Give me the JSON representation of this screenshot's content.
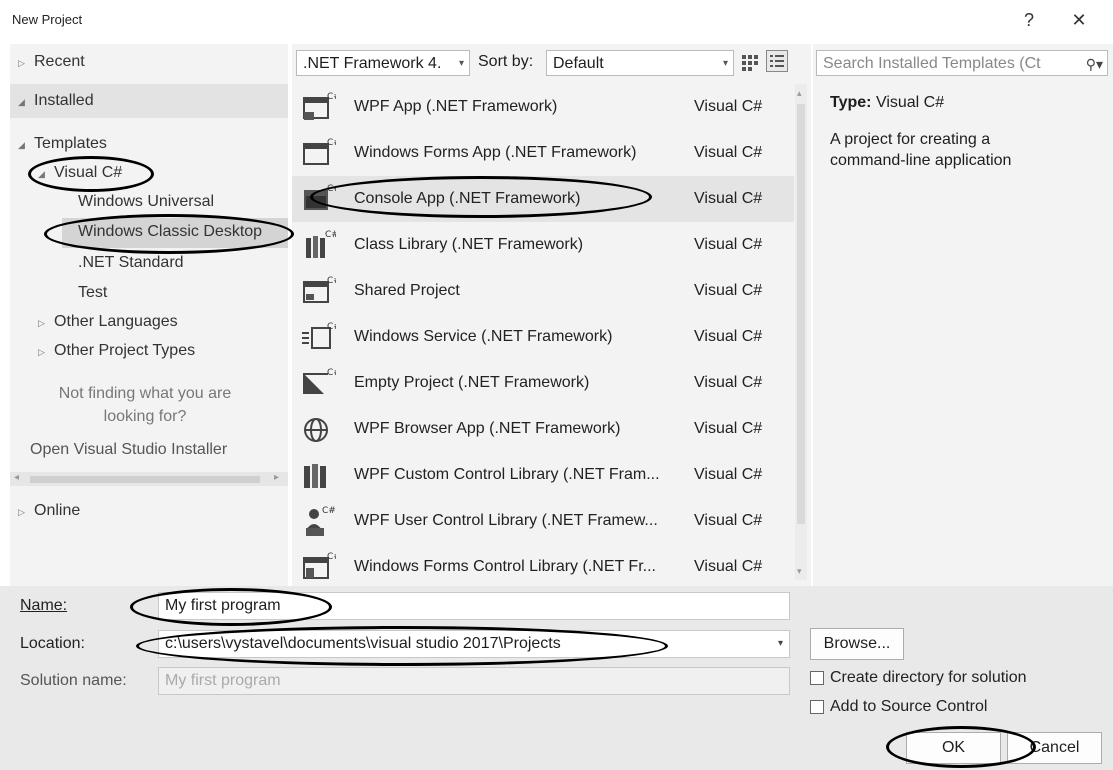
{
  "window": {
    "title": "New Project",
    "help_label": "?",
    "close_label": "✕"
  },
  "left_nav": {
    "recent": "Recent",
    "installed": "Installed",
    "templates": "Templates",
    "visual_csharp": "Visual C#",
    "windows_universal": "Windows Universal",
    "windows_classic_desktop": "Windows Classic Desktop",
    "net_standard": ".NET Standard",
    "test": "Test",
    "other_languages": "Other Languages",
    "other_project_types": "Other Project Types",
    "not_finding_1": "Not finding what you are",
    "not_finding_2": "looking for?",
    "open_installer": "Open Visual Studio Installer",
    "online": "Online"
  },
  "toolbar": {
    "framework": ".NET Framework 4.",
    "sort_label": "Sort by:",
    "sort_value": "Default",
    "search_placeholder": "Search Installed Templates (Ct"
  },
  "templates": [
    {
      "name": "WPF App (.NET Framework)",
      "lang": "Visual C#",
      "icon": "wpf-app-icon"
    },
    {
      "name": "Windows Forms App (.NET Framework)",
      "lang": "Visual C#",
      "icon": "windows-forms-icon"
    },
    {
      "name": "Console App (.NET Framework)",
      "lang": "Visual C#",
      "icon": "console-app-icon"
    },
    {
      "name": "Class Library (.NET Framework)",
      "lang": "Visual C#",
      "icon": "class-library-icon"
    },
    {
      "name": "Shared Project",
      "lang": "Visual C#",
      "icon": "shared-project-icon"
    },
    {
      "name": "Windows Service (.NET Framework)",
      "lang": "Visual C#",
      "icon": "windows-service-icon"
    },
    {
      "name": "Empty Project (.NET Framework)",
      "lang": "Visual C#",
      "icon": "empty-project-icon"
    },
    {
      "name": "WPF Browser App (.NET Framework)",
      "lang": "Visual C#",
      "icon": "wpf-browser-icon"
    },
    {
      "name": "WPF Custom Control Library (.NET Fram...",
      "lang": "Visual C#",
      "icon": "wpf-custom-control-icon"
    },
    {
      "name": "WPF User Control Library (.NET Framew...",
      "lang": "Visual C#",
      "icon": "wpf-user-control-icon"
    },
    {
      "name": "Windows Forms Control Library (.NET Fr...",
      "lang": "Visual C#",
      "icon": "winforms-control-icon"
    }
  ],
  "details": {
    "type_label": "Type:",
    "type_value": "Visual C#",
    "description": "A project for creating a command-line application"
  },
  "form": {
    "name_label": "Name:",
    "name_value": "My first program",
    "location_label": "Location:",
    "location_value": "c:\\users\\vystavel\\documents\\visual studio 2017\\Projects",
    "solution_label": "Solution name:",
    "solution_value": "My first program",
    "browse_label": "Browse...",
    "create_dir_label": "Create directory for solution",
    "source_control_label": "Add to Source Control",
    "ok_label": "OK",
    "cancel_label": "Cancel"
  }
}
